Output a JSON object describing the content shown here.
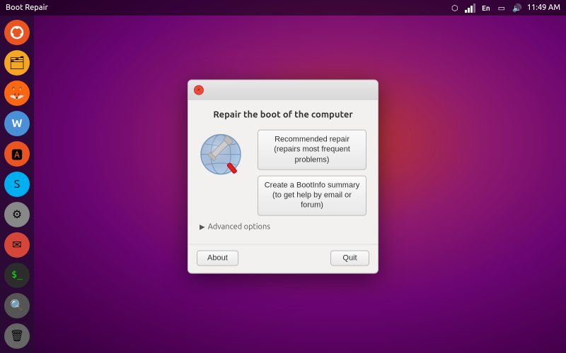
{
  "window_title": "Boot Repair",
  "taskbar": {
    "title": "Boot Repair",
    "time": "11:49 AM",
    "icons": [
      "dropbox",
      "signal",
      "en",
      "battery",
      "speaker"
    ]
  },
  "sidebar": {
    "items": [
      {
        "name": "ubuntu-home",
        "label": "Ubuntu Home"
      },
      {
        "name": "files",
        "label": "Files"
      },
      {
        "name": "firefox",
        "label": "Firefox"
      },
      {
        "name": "writer",
        "label": "LibreOffice Writer"
      },
      {
        "name": "app-center",
        "label": "App Center"
      },
      {
        "name": "skype",
        "label": "Skype"
      },
      {
        "name": "system",
        "label": "System Settings"
      },
      {
        "name": "email",
        "label": "Email"
      },
      {
        "name": "terminal",
        "label": "Terminal"
      },
      {
        "name": "search",
        "label": "Search"
      },
      {
        "name": "trash",
        "label": "Trash"
      }
    ]
  },
  "dialog": {
    "title": "Repair the boot of the computer",
    "close_label": "×",
    "recommended_repair_line1": "Recommended repair",
    "recommended_repair_line2": "(repairs most frequent problems)",
    "bootinfo_line1": "Create a BootInfo summary",
    "bootinfo_line2": "(to get help by email or forum)",
    "advanced_options_label": "Advanced options",
    "about_label": "About",
    "quit_label": "Quit"
  }
}
